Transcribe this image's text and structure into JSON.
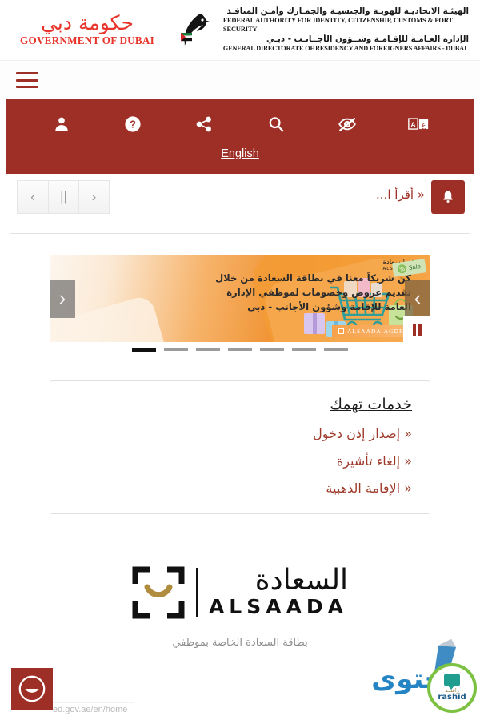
{
  "header": {
    "gov_logo": {
      "arabic": "حكومة دبي",
      "english": "GOVERNMENT OF DUBAI",
      "color": "#e8352c"
    },
    "authority": {
      "arabic_line1": "الهيئـة الاتحاديـة للهويـة والجنسيـة والجمـارك وأمـن المنافـذ",
      "english_line1": "FEDERAL AUTHORITY FOR IDENTITY, CITIZENSHIP, CUSTOMS & PORT SECURITY",
      "arabic_line2": "الإدارة العـامـة للإقـامـة وشــؤون الأجــانـب - دبـي",
      "english_line2": "GENERAL DIRECTORATE OF RESIDENCY AND FOREIGNERS AFFAIRS - DUBAI"
    },
    "menu_label": "القائمة"
  },
  "utility_bar": {
    "background": "#9e2f26",
    "icons": [
      {
        "name": "user-icon",
        "label": "تسجيل الدخول"
      },
      {
        "name": "help-icon",
        "label": "المساعدة"
      },
      {
        "name": "share-icon",
        "label": "مشاركة"
      },
      {
        "name": "search-icon",
        "label": "بحث"
      },
      {
        "name": "eye-slash-icon",
        "label": "ذوي الهمم"
      },
      {
        "name": "translate-icon",
        "label": "ترجمة"
      }
    ],
    "language_label": "English"
  },
  "ticker": {
    "prev_label": "‹",
    "pause_label": "||",
    "next_label": "›",
    "text": "« أقرأ ا...",
    "bell_label": "تنبيهات"
  },
  "banner": {
    "logo_arabic": "السعادة",
    "logo_english": "ALSAADA",
    "headline": "كن شريكاً معنا في بطاقة السعادة من خلال تقديم عروض وخصومات لموظفي الإدارة العامة للإقامة وشؤون الأجانب - دبي",
    "sale_tag": "Sale",
    "sale_percent": "%",
    "ribbon": "ALSAADA.AGDRFA",
    "prev_label": "‹",
    "next_label": "›",
    "pause_label": "إيقاف",
    "dots": [
      {
        "active": false
      },
      {
        "active": false
      },
      {
        "active": false
      },
      {
        "active": false
      },
      {
        "active": false
      },
      {
        "active": false
      },
      {
        "active": true
      }
    ]
  },
  "services": {
    "title": "خدمات تهمك",
    "links": [
      "« إصدار إذن دخول",
      "« إلغاء تأشيرة",
      "« الإقامة الذهبية"
    ]
  },
  "footer_brand": {
    "arabic": "السعادة",
    "english": "ALSAADA",
    "caption": "بطاقة السعادة الخاصة بموظفي"
  },
  "widgets": {
    "smiley_label": "تقييم",
    "status_url": "ed.gov.ae/en/home",
    "watermark": "محتوى",
    "rashid_arabic": "راشــد",
    "rashid_english": "rashid"
  }
}
